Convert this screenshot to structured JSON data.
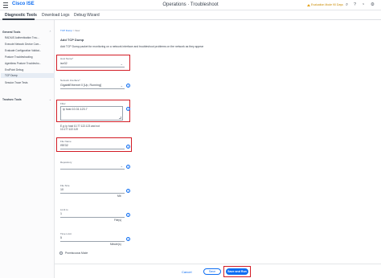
{
  "header": {
    "brand": "Cisco ISE",
    "title": "Operations · Troubleshoot",
    "eval_notice": "Evaluation Mode 90 Days",
    "icons": [
      "menu-icon",
      "search-icon",
      "help-icon",
      "notifications-icon",
      "settings-icon"
    ]
  },
  "tabs": [
    {
      "label": "Diagnostic Tools",
      "active": true
    },
    {
      "label": "Download Logs",
      "active": false
    },
    {
      "label": "Debug Wizard",
      "active": false
    }
  ],
  "sidebar": {
    "sections": [
      {
        "title": "General Tools",
        "items": [
          "RADIUS Authentication Trou...",
          "Execute Network Device Com...",
          "Evaluate Configuration Validat...",
          "Posture Troubleshooting",
          "Agentless Posture Troublesho...",
          "EndPoint Debug",
          "TCP Dump",
          "Session Trace Tests"
        ],
        "selected": "TCP Dump"
      },
      {
        "title": "Trustsec Tools",
        "items": []
      }
    ]
  },
  "breadcrumb": {
    "link": "TCP Dump",
    "separator": ">",
    "current": "New"
  },
  "form": {
    "heading": "Add TCP Dump",
    "description": "Add TCP Dump packet for monitoring on a network interface and troubleshoot problems on the network as they appear",
    "host_name": {
      "label": "Host Name*",
      "value": "ise32"
    },
    "network_interface": {
      "label": "Network Interface*",
      "value": "GigabitEthernet 0 [Up, Running]"
    },
    "filter": {
      "label": "Filter",
      "value": "ip host 10.31.123.7",
      "hint_line1": "E.g: ip host 10.77.122.123 and not",
      "hint_line2": "10.177.122.119"
    },
    "file_name": {
      "label": "File Name",
      "value": "ISE32"
    },
    "repository": {
      "label": "Repository",
      "value": ""
    },
    "file_size": {
      "label": "File Size",
      "value": "10",
      "unit": "Mb"
    },
    "limit_to": {
      "label": "Limit to",
      "value": "1",
      "unit": "File(s)"
    },
    "time_limit": {
      "label": "Time Limit",
      "value": "5",
      "unit": "Minute(s)"
    },
    "promiscuous": {
      "label": "Promiscuous Mode",
      "checked": false
    }
  },
  "buttons": {
    "cancel": "Cancel",
    "save": "Save",
    "save_and_run": "Save and Run"
  },
  "colors": {
    "accent": "#0d6df2",
    "highlight": "#d21c25",
    "eval_warning": "#e5a21a"
  }
}
